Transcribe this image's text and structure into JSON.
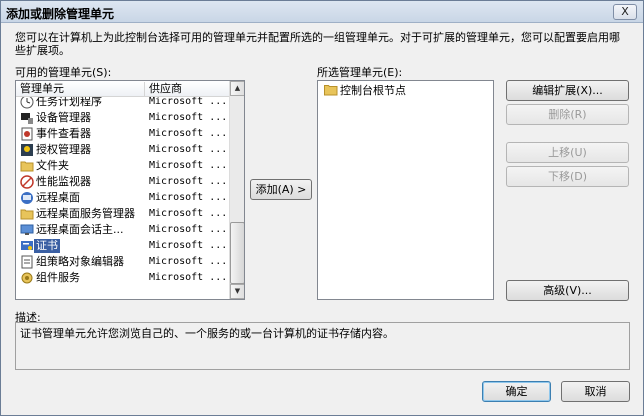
{
  "window": {
    "title": "添加或删除管理单元",
    "close_label": "X"
  },
  "intro_text": "您可以在计算机上为此控制台选择可用的管理单元并配置所选的一组管理单元。对于可扩展的管理单元，您可以配置要启用哪些扩展项。",
  "available": {
    "label": "可用的管理单元(S):",
    "columns": [
      "管理单元",
      "供应商"
    ],
    "items": [
      {
        "name": "任务计划程序",
        "vendor": "Microsoft ...",
        "icon": "task-scheduler-icon"
      },
      {
        "name": "设备管理器",
        "vendor": "Microsoft ...",
        "icon": "device-manager-icon"
      },
      {
        "name": "事件查看器",
        "vendor": "Microsoft ...",
        "icon": "event-viewer-icon"
      },
      {
        "name": "授权管理器",
        "vendor": "Microsoft ...",
        "icon": "authorization-manager-icon"
      },
      {
        "name": "文件夹",
        "vendor": "Microsoft ...",
        "icon": "folder-icon"
      },
      {
        "name": "性能监视器",
        "vendor": "Microsoft ...",
        "icon": "performance-monitor-icon"
      },
      {
        "name": "远程桌面",
        "vendor": "Microsoft ...",
        "icon": "remote-desktop-icon"
      },
      {
        "name": "远程桌面服务管理器",
        "vendor": "Microsoft ...",
        "icon": "folder-icon"
      },
      {
        "name": "远程桌面会话主...",
        "vendor": "Microsoft ...",
        "icon": "session-host-icon"
      },
      {
        "name": "证书",
        "vendor": "Microsoft ...",
        "icon": "certificate-icon",
        "selected": true
      },
      {
        "name": "组策略对象编辑器",
        "vendor": "Microsoft ...",
        "icon": "group-policy-icon"
      },
      {
        "name": "组件服务",
        "vendor": "Microsoft ...",
        "icon": "component-services-icon"
      }
    ]
  },
  "add_button": "添加(A) >",
  "selected": {
    "label": "所选管理单元(E):",
    "root_node": "控制台根节点"
  },
  "buttons": {
    "edit_extensions": "编辑扩展(X)...",
    "remove": "删除(R)",
    "move_up": "上移(U)",
    "move_down": "下移(D)",
    "advanced": "高级(V)...",
    "ok": "确定",
    "cancel": "取消"
  },
  "description": {
    "label": "描述:",
    "text": "证书管理单元允许您浏览自己的、一个服务的或一台计算机的证书存储内容。"
  },
  "colors": {
    "selection": "#3a5fa3",
    "folder": "#e8c45a"
  }
}
